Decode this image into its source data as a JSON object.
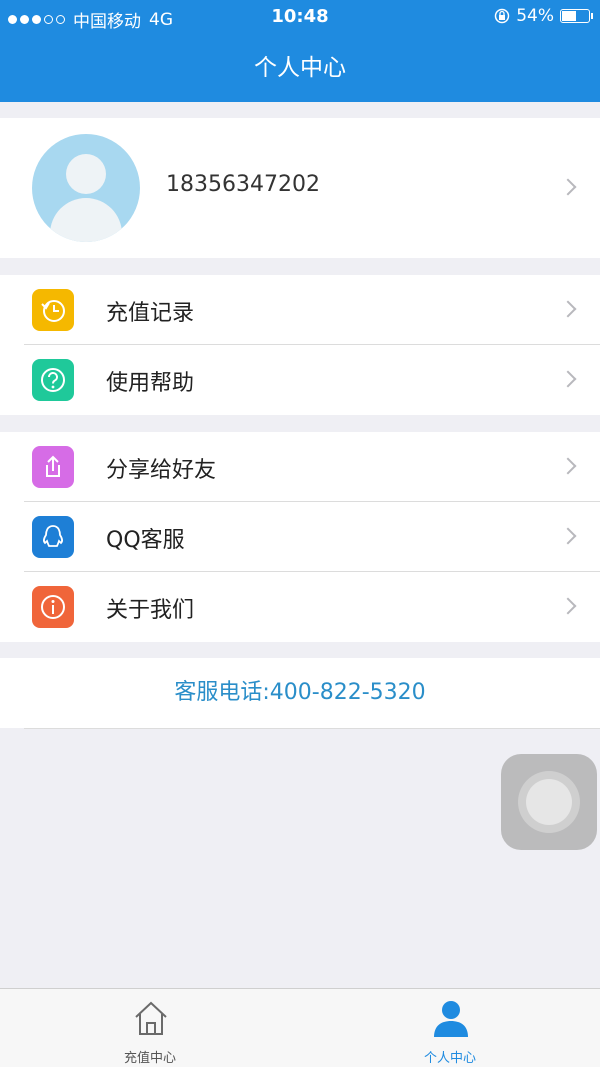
{
  "status_bar": {
    "carrier": "中国移动",
    "network": "4G",
    "time": "10:48",
    "battery": "54%"
  },
  "nav": {
    "title": "个人中心"
  },
  "profile": {
    "phone": "18356347202"
  },
  "menu_group_1": [
    {
      "label": "充值记录",
      "icon": "clock-icon",
      "color": "#f5b800"
    },
    {
      "label": "使用帮助",
      "icon": "help-icon",
      "color": "#1fc99a"
    }
  ],
  "menu_group_2": [
    {
      "label": "分享给好友",
      "icon": "share-icon",
      "color": "#d66ce6"
    },
    {
      "label": "QQ客服",
      "icon": "qq-icon",
      "color": "#1e7fd6"
    },
    {
      "label": "关于我们",
      "icon": "info-icon",
      "color": "#f0653a"
    }
  ],
  "hotline": {
    "text": "客服电话:400-822-5320"
  },
  "tabbar": {
    "tabs": [
      {
        "label": "充值中心",
        "icon": "home-icon",
        "active": false
      },
      {
        "label": "个人中心",
        "icon": "person-icon",
        "active": true
      }
    ],
    "active_color": "#1f8be0",
    "inactive_color": "#555555"
  }
}
